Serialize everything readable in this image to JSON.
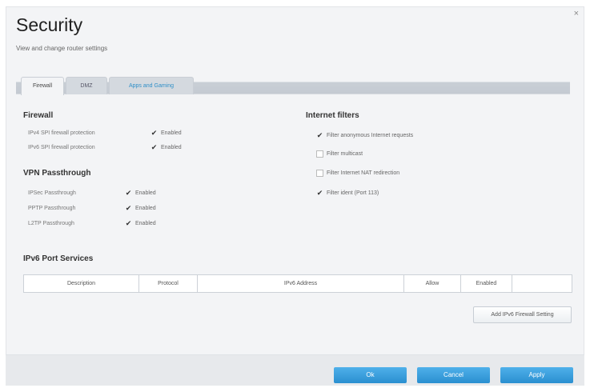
{
  "window": {
    "close_glyph": "×"
  },
  "header": {
    "title": "Security",
    "subtitle": "View and change router settings"
  },
  "tabs": [
    {
      "label": "Firewall"
    },
    {
      "label": "DMZ"
    },
    {
      "label": "Apps and Gaming"
    }
  ],
  "firewall": {
    "title": "Firewall",
    "rows": [
      {
        "label": "IPv4 SPI firewall protection",
        "checked": true,
        "state": "Enabled"
      },
      {
        "label": "IPv6 SPI firewall protection",
        "checked": true,
        "state": "Enabled"
      }
    ]
  },
  "vpn": {
    "title": "VPN Passthrough",
    "rows": [
      {
        "label": "IPSec Passthrough",
        "checked": true,
        "state": "Enabled"
      },
      {
        "label": "PPTP Passthrough",
        "checked": true,
        "state": "Enabled"
      },
      {
        "label": "L2TP Passthrough",
        "checked": true,
        "state": "Enabled"
      }
    ]
  },
  "internet_filters": {
    "title": "Internet filters",
    "items": [
      {
        "label": "Filter anonymous Internet requests",
        "checked": true
      },
      {
        "label": "Filter multicast",
        "checked": false
      },
      {
        "label": "Filter Internet NAT redirection",
        "checked": false
      },
      {
        "label": "Filter ident (Port 113)",
        "checked": true
      }
    ]
  },
  "ipv6": {
    "title": "IPv6 Port Services",
    "columns": [
      "Description",
      "Protocol",
      "IPv6 Address",
      "Allow",
      "Enabled",
      ""
    ],
    "add_button": "Add IPv6 Firewall Setting"
  },
  "footer": {
    "ok": "Ok",
    "cancel": "Cancel",
    "apply": "Apply"
  },
  "colors": {
    "accent": "#2a8fd0",
    "link": "#2f8fc8"
  },
  "icons": {
    "check": "✔"
  }
}
